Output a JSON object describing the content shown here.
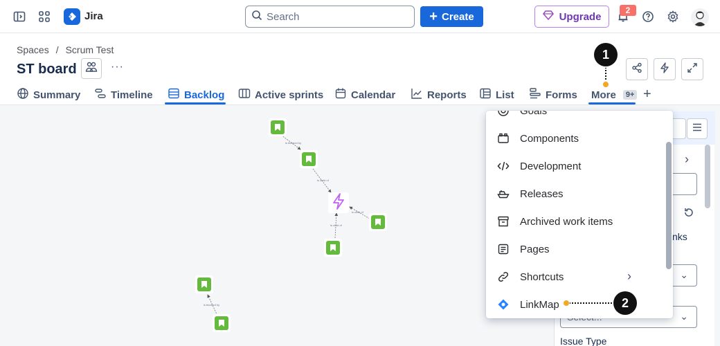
{
  "topbar": {
    "app_name": "Jira",
    "search_placeholder": "Search",
    "create_label": "Create",
    "upgrade_label": "Upgrade",
    "notification_count": "2"
  },
  "header": {
    "breadcrumb": [
      "Spaces",
      "/",
      "Scrum Test"
    ],
    "title": "ST board",
    "more_actions": "···"
  },
  "tabs": [
    {
      "label": "Summary",
      "icon": "globe-icon"
    },
    {
      "label": "Timeline",
      "icon": "timeline-icon"
    },
    {
      "label": "Backlog",
      "icon": "backlog-icon",
      "active": true
    },
    {
      "label": "Active sprints",
      "icon": "board-icon"
    },
    {
      "label": "Calendar",
      "icon": "calendar-icon"
    },
    {
      "label": "Reports",
      "icon": "chart-icon"
    },
    {
      "label": "List",
      "icon": "list-icon"
    },
    {
      "label": "Forms",
      "icon": "forms-icon"
    },
    {
      "label": "More",
      "badge": "9+"
    }
  ],
  "menu": {
    "items": [
      {
        "label": "Goals",
        "icon": "goals-icon"
      },
      {
        "label": "Components",
        "icon": "components-icon"
      },
      {
        "label": "Development",
        "icon": "code-icon"
      },
      {
        "label": "Releases",
        "icon": "ship-icon"
      },
      {
        "label": "Archived work items",
        "icon": "archive-icon"
      },
      {
        "label": "Pages",
        "icon": "page-icon"
      },
      {
        "label": "Shortcuts",
        "icon": "link-icon",
        "chevron": "›"
      },
      {
        "label": "LinkMap",
        "icon": "linkmap-icon"
      }
    ]
  },
  "right_panel": {
    "links_fragment": "nks",
    "select_placeholder": "Select...",
    "issue_type_label": "Issue Type"
  },
  "callouts": {
    "one": "1",
    "two": "2"
  },
  "canvas": {
    "edge_labels": [
      "is blocked by",
      "is child of",
      "is child of",
      "is child of",
      "is blocked by"
    ]
  },
  "colors": {
    "accent": "#1868db",
    "story_green": "#63ba3c",
    "epic_purple": "#bf63f3",
    "callout_dot": "#f5a623"
  }
}
